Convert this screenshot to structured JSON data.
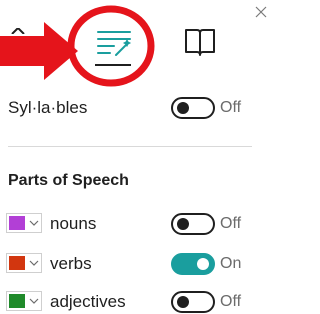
{
  "colors": {
    "annotation_red": "#e5141b",
    "toggle_on": "#1a9e9e",
    "nouns": "#b23fd6",
    "verbs": "#d2360f",
    "adjectives": "#1f8a2a"
  },
  "toolbar": {
    "tabs": [
      {
        "icon": "grammar-options-icon",
        "selected": true
      },
      {
        "icon": "book-icon",
        "selected": false
      }
    ]
  },
  "syllables": {
    "label": "Syl·la·bles",
    "state": "Off",
    "on": false
  },
  "parts_of_speech": {
    "title": "Parts of Speech",
    "items": [
      {
        "label": "nouns",
        "state": "Off",
        "on": false,
        "color": "#b23fd6"
      },
      {
        "label": "verbs",
        "state": "On",
        "on": true,
        "color": "#d2360f"
      },
      {
        "label": "adjectives",
        "state": "Off",
        "on": false,
        "color": "#1f8a2a"
      }
    ]
  }
}
